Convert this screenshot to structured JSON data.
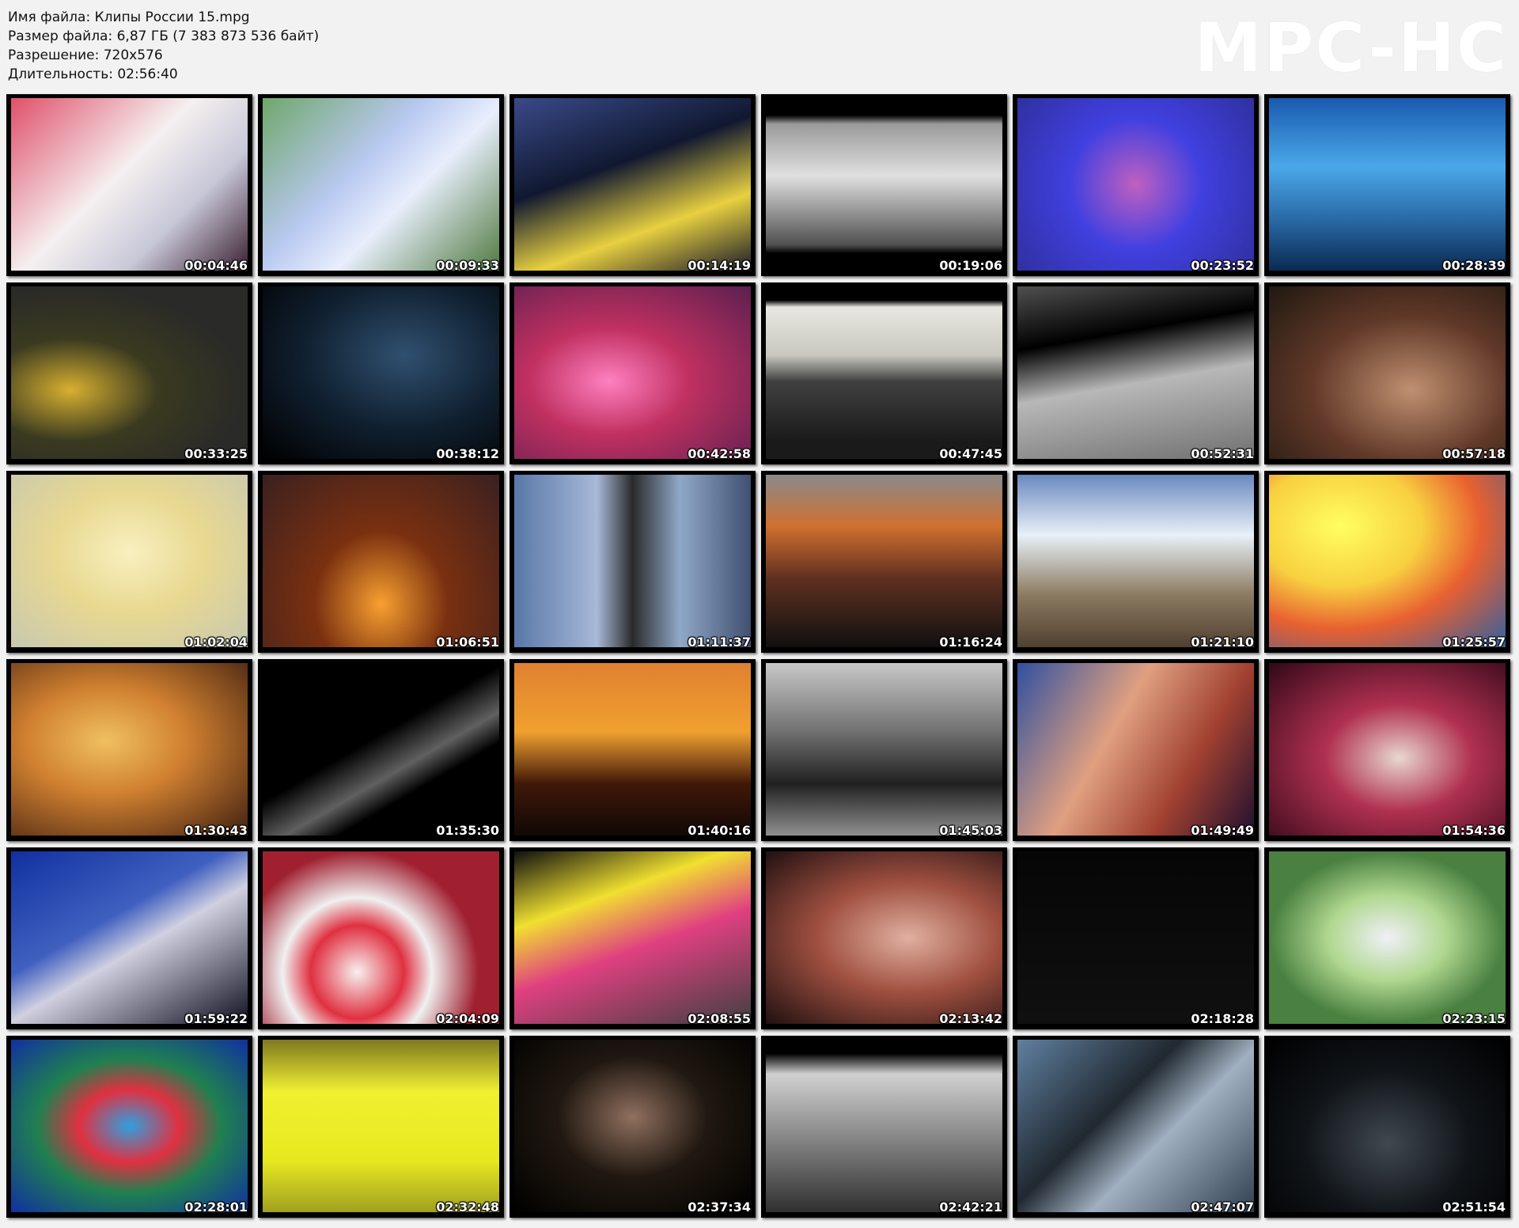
{
  "header": {
    "filename": "Имя файла: Клипы России 15.mpg",
    "filesize": "Размер файла: 6,87 ГБ (7 383 873 536 байт)",
    "resolution": "Разрешение: 720x576",
    "duration": "Длительность: 02:56:40"
  },
  "logo": "MPC-HC",
  "thumbnails": [
    {
      "time": "00:04:46",
      "bg": "linear-gradient(135deg,#e0506a,#f5f0f0 45%,#c8c8d8 70%,#3a2030)"
    },
    {
      "time": "00:09:33",
      "bg": "linear-gradient(135deg,#6fa86a,#b8c8f0 40%,#e8eefc 60%,#4f7a40)"
    },
    {
      "time": "00:14:19",
      "bg": "linear-gradient(160deg,#3a4a8a,#101830 40%,#e8d040 70%,#1a1a2a)"
    },
    {
      "time": "00:19:06",
      "bg": "linear-gradient(180deg,#000 10%,#9a9a9a 15%,#e0e0e0 45%,#505050 85%,#000 90%)"
    },
    {
      "time": "00:23:52",
      "bg": "radial-gradient(circle at 50% 50%,#c060c0,#4040e0 45%,#3030a0)"
    },
    {
      "time": "00:28:39",
      "bg": "linear-gradient(180deg,#1a5ab0,#4aa8e8 40%,#2a6aa8 70%,#0a2a50)"
    },
    {
      "time": "00:33:25",
      "bg": "radial-gradient(ellipse at 25% 60%,#d8b030,#3a3a20 35%,#2a2a28 70%)"
    },
    {
      "time": "00:38:12",
      "bg": "radial-gradient(ellipse at 60% 40%,#305070,#102030 50%,#000)"
    },
    {
      "time": "00:42:58",
      "bg": "radial-gradient(ellipse at 40% 55%,#ff80c0,#c03060 40%,#5a2050)"
    },
    {
      "time": "00:47:45",
      "bg": "linear-gradient(180deg,#000 8%,#e8e8e0 12%,#c8c8c0 40%,#404040 55%,#1a1a1a 90%)"
    },
    {
      "time": "00:52:31",
      "bg": "linear-gradient(170deg,#505050,#000 30%,#b8b8b8 55%,#707070)"
    },
    {
      "time": "00:57:18",
      "bg": "radial-gradient(ellipse at 60% 60%,#c09070,#603828 50%,#201810)"
    },
    {
      "time": "01:02:04",
      "bg": "radial-gradient(ellipse at 50% 45%,#f8f0c0,#e8d890 45%,#c8c8b0)"
    },
    {
      "time": "01:06:51",
      "bg": "radial-gradient(ellipse at 50% 75%,#f8a030,#7a3010 40%,#3a2020)"
    },
    {
      "time": "01:11:37",
      "bg": "linear-gradient(90deg,#5878a8,#a8b8d8 35%,#2a2a2a 50%,#90a8c8 70%,#405070)"
    },
    {
      "time": "01:16:24",
      "bg": "linear-gradient(180deg,#8a8a8a,#d07030 30%,#603020 60%,#101010)"
    },
    {
      "time": "01:21:10",
      "bg": "linear-gradient(180deg,#6a88c0,#e8f0f8 35%,#8a7a60 70%,#504030)"
    },
    {
      "time": "01:25:57",
      "bg": "radial-gradient(ellipse at 30% 30%,#ffff60,#f8d040 35%,#e86030 60%,#3060a0)"
    },
    {
      "time": "01:30:43",
      "bg": "radial-gradient(ellipse at 40% 45%,#f0c060,#d08030 40%,#402010)"
    },
    {
      "time": "01:35:30",
      "bg": "linear-gradient(150deg,#000 45%,#606060 60%,#000 70%)"
    },
    {
      "time": "01:40:16",
      "bg": "linear-gradient(180deg,#e08030,#f0a030 40%,#401808 70%,#100806)"
    },
    {
      "time": "01:45:03",
      "bg": "linear-gradient(180deg,#c8c8c8,#707070 40%,#202020 70%,#909090)"
    },
    {
      "time": "01:49:49",
      "bg": "linear-gradient(120deg,#3050a0,#e0a080 40%,#a04030 70%,#201030)"
    },
    {
      "time": "01:54:36",
      "bg": "radial-gradient(ellipse at 55% 55%,#e8d8d0,#b03050 40%,#300818)"
    },
    {
      "time": "01:59:22",
      "bg": "linear-gradient(150deg,#1030a0,#4060c0 40%,#d0d0e0 55%,#101020)"
    },
    {
      "time": "02:04:09",
      "bg": "radial-gradient(circle at 40% 70%,#f8f0f0,#e03040 25%,#f0f0f0 40%,#a02030 65%)"
    },
    {
      "time": "02:08:55",
      "bg": "linear-gradient(160deg,#101010,#f0e030 30%,#e04080 55%,#404040)"
    },
    {
      "time": "02:13:42",
      "bg": "radial-gradient(ellipse at 60% 50%,#e0b0a0,#a05040 45%,#201010)"
    },
    {
      "time": "02:18:28",
      "bg": "linear-gradient(180deg,#060606,#101010)"
    },
    {
      "time": "02:23:15",
      "bg": "radial-gradient(ellipse at 50% 50%,#f0f0f8,#b0d890 35%,#4a8040 70%)"
    },
    {
      "time": "02:28:01",
      "bg": "radial-gradient(ellipse at 50% 50%,#30a0e0,#e03040 30%,#208050 55%,#1030a0)"
    },
    {
      "time": "02:32:48",
      "bg": "linear-gradient(180deg,#807820,#f0f030 30%,#e8e820 70%,#a0a020)"
    },
    {
      "time": "02:37:34",
      "bg": "radial-gradient(ellipse at 50% 45%,#907060,#201810 45%,#000)"
    },
    {
      "time": "02:42:21",
      "bg": "linear-gradient(180deg,#000 8%,#d0d0d0 20%,#808080 60%,#303030)"
    },
    {
      "time": "02:47:07",
      "bg": "linear-gradient(135deg,#6080a0,#202830 40%,#a0b0c0 60%,#304050)"
    },
    {
      "time": "02:51:54",
      "bg": "radial-gradient(ellipse at 50% 60%,#404850,#101418 50%,#000)"
    }
  ]
}
